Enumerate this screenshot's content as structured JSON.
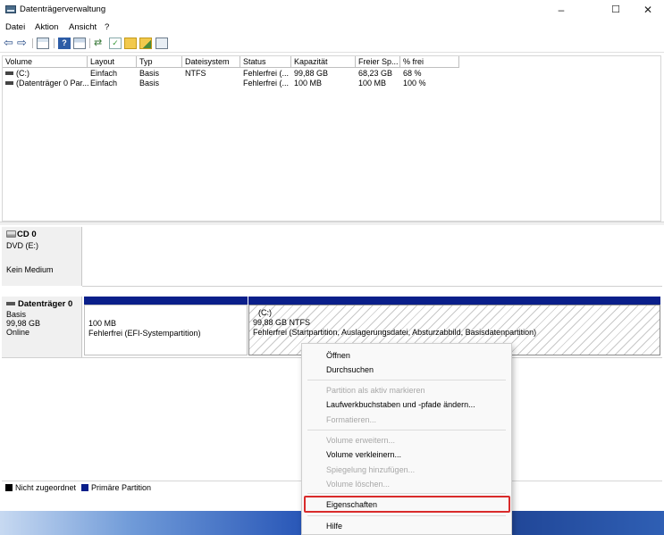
{
  "window": {
    "title": "Datenträgerverwaltung",
    "controls": {
      "minimize": "–",
      "maximize": "☐",
      "close": "✕"
    }
  },
  "menu": [
    "Datei",
    "Aktion",
    "Ansicht",
    "?"
  ],
  "toolbar": {
    "icons": [
      "back-arrow-icon",
      "forward-arrow-icon",
      "console-tree-icon",
      "help-icon",
      "properties-icon",
      "connect-icon",
      "check-icon",
      "folder-icon",
      "folder-open-icon",
      "view-icon"
    ]
  },
  "volume_list": {
    "columns": [
      "Volume",
      "Layout",
      "Typ",
      "Dateisystem",
      "Status",
      "Kapazität",
      "Freier Sp...",
      "% frei"
    ],
    "rows": [
      [
        "(C:)",
        "Einfach",
        "Basis",
        "NTFS",
        "Fehlerfrei (...",
        "99,88 GB",
        "68,23 GB",
        "68 %"
      ],
      [
        "(Datenträger 0 Par...",
        "Einfach",
        "Basis",
        "",
        "Fehlerfrei (...",
        "100 MB",
        "100 MB",
        "100 %"
      ]
    ]
  },
  "disks": {
    "cd": {
      "title": "CD 0",
      "line1": "DVD (E:)",
      "line2": "Kein Medium"
    },
    "disk0": {
      "title": "Datenträger 0",
      "line1": "Basis",
      "line2": "99,98 GB",
      "line3": "Online",
      "partition_efi": {
        "size": "100 MB",
        "status": "Fehlerfrei (EFI-Systempartition)"
      },
      "partition_c": {
        "label": "(C:)",
        "size": "99,88 GB NTFS",
        "status": "Fehlerfrei (Startpartition, Auslagerungsdatei, Absturzabbild, Basisdatenpartition)"
      }
    }
  },
  "legend": {
    "unallocated": "Nicht zugeordnet",
    "primary": "Primäre Partition",
    "unallocated_color": "#000000",
    "primary_color": "#0a1f8a"
  },
  "context_menu": {
    "open": "Öffnen",
    "explore": "Durchsuchen",
    "mark_active": "Partition als aktiv markieren",
    "change_letter": "Laufwerkbuchstaben und -pfade ändern...",
    "format": "Formatieren...",
    "extend": "Volume erweitern...",
    "shrink": "Volume verkleinern...",
    "add_mirror": "Spiegelung hinzufügen...",
    "delete": "Volume löschen...",
    "properties": "Eigenschaften",
    "help": "Hilfe"
  }
}
